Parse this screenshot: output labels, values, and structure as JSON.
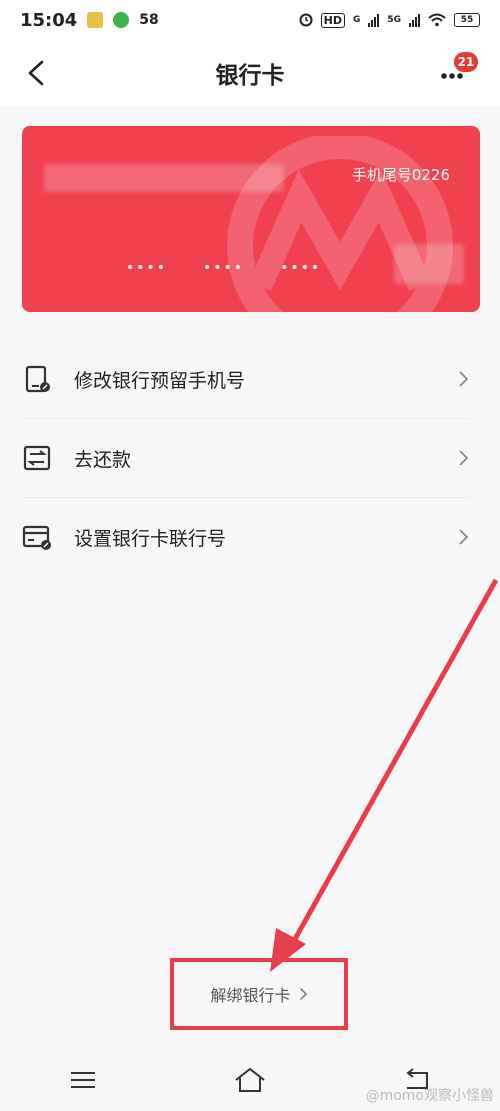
{
  "status": {
    "time": "15:04",
    "notification_count": "58",
    "hd_label": "HD",
    "network_1": "G",
    "network_2": "5G",
    "battery": "55"
  },
  "nav": {
    "title": "银行卡",
    "badge_count": "21"
  },
  "card": {
    "phone_suffix": "手机尾号0226",
    "number_groups": [
      "••••",
      "••••",
      "••••"
    ]
  },
  "menu": {
    "items": [
      {
        "label": "修改银行预留手机号",
        "icon": "phone-edit-icon"
      },
      {
        "label": "去还款",
        "icon": "repay-icon"
      },
      {
        "label": "设置银行卡联行号",
        "icon": "card-settings-icon"
      }
    ]
  },
  "unbind": {
    "label": "解绑银行卡"
  },
  "watermark": "@momo观察小怪兽",
  "colors": {
    "card": "#f0414f",
    "annotation": "#e83e4c",
    "badge": "#e53935"
  }
}
